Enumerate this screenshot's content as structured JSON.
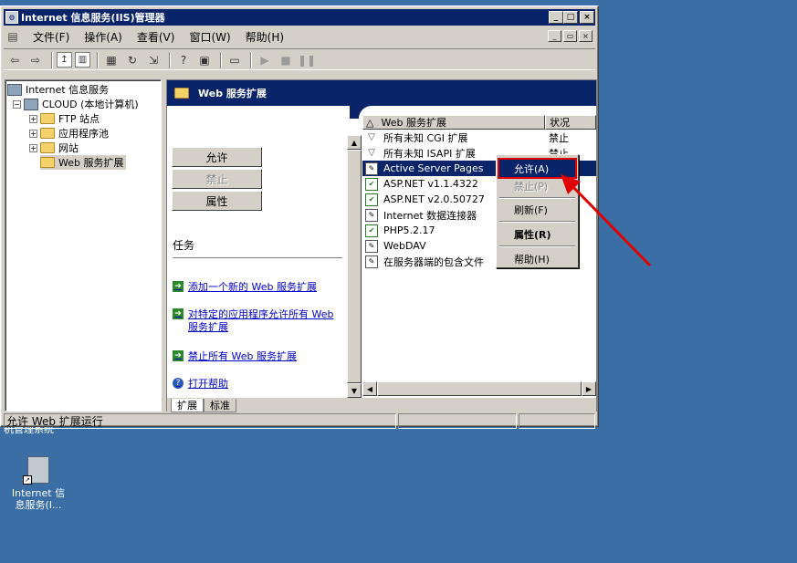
{
  "window": {
    "title": "Internet 信息服务(IIS)管理器",
    "controls": {
      "min": "_",
      "max": "□",
      "close": "×"
    },
    "mdi_controls": {
      "min": "_",
      "restore": "▭",
      "close": "×"
    }
  },
  "menubar": [
    "文件(F)",
    "操作(A)",
    "查看(V)",
    "窗口(W)",
    "帮助(H)"
  ],
  "tree": {
    "root": "Internet 信息服务",
    "computer": "CLOUD (本地计算机)",
    "children": [
      "FTP 站点",
      "应用程序池",
      "网站",
      "Web 服务扩展"
    ]
  },
  "pane": {
    "banner_title": "Web 服务扩展",
    "buttons": {
      "allow": "允许",
      "prohibit": "禁止",
      "properties": "属性"
    },
    "tasks_label": "任务",
    "tasks": [
      "添加一个新的 Web 服务扩展",
      "对特定的应用程序允许所有 Web 服务扩展",
      "禁止所有 Web 服务扩展",
      "打开帮助"
    ],
    "list_headers": {
      "name": "Web 服务扩展",
      "status": "状况"
    },
    "list_rows": [
      {
        "name": "所有未知 CGI 扩展",
        "status": "禁止"
      },
      {
        "name": "所有未知 ISAPI 扩展",
        "status": "禁止"
      },
      {
        "name": "Active Server Pages",
        "status": ""
      },
      {
        "name": "ASP.NET v1.1.4322",
        "status": ""
      },
      {
        "name": "ASP.NET v2.0.50727",
        "status": ""
      },
      {
        "name": "Internet 数据连接器",
        "status": ""
      },
      {
        "name": "PHP5.2.17",
        "status": ""
      },
      {
        "name": "WebDAV",
        "status": ""
      },
      {
        "name": "在服务器端的包含文件",
        "status": ""
      }
    ],
    "tabs": [
      "扩展",
      "标准"
    ]
  },
  "context_menu": {
    "allow": "允许(A)",
    "prohibit": "禁止(P)",
    "refresh": "刷新(F)",
    "properties": "属性(R)",
    "help": "帮助(H)"
  },
  "statusbar": {
    "text": "允许 Web 扩展运行"
  },
  "desktop": {
    "partial_label": "机管理系统",
    "icon_label_line1": "Internet 信",
    "icon_label_line2": "息服务(I..."
  },
  "colors": {
    "titlebar": "#0a246a",
    "desktop": "#3a6ea5",
    "highlight": "#e00000"
  }
}
